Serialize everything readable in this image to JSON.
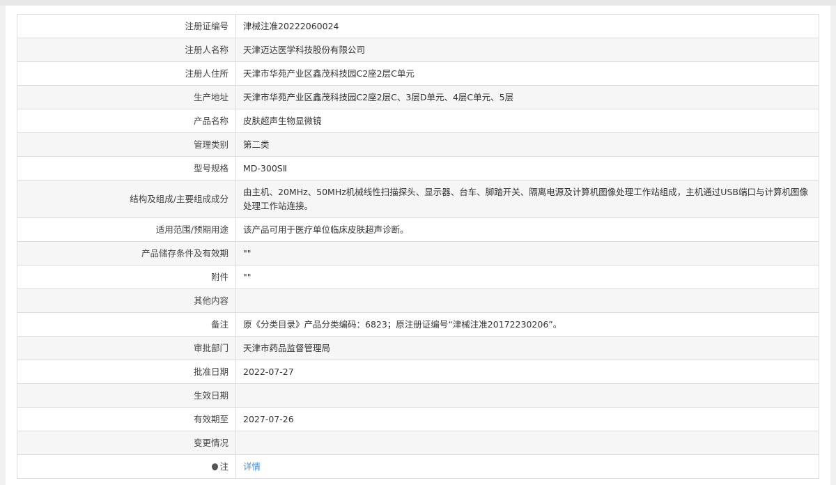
{
  "rows": [
    {
      "label": "注册证编号",
      "value": "津械注准20222060024"
    },
    {
      "label": "注册人名称",
      "value": "天津迈达医学科技股份有限公司"
    },
    {
      "label": "注册人住所",
      "value": "天津市华苑产业区鑫茂科技园C2座2层C单元"
    },
    {
      "label": "生产地址",
      "value": "天津市华苑产业区鑫茂科技园C2座2层C、3层D单元、4层C单元、5层"
    },
    {
      "label": "产品名称",
      "value": "皮肤超声生物显微镜"
    },
    {
      "label": "管理类别",
      "value": "第二类"
    },
    {
      "label": "型号规格",
      "value": "MD-300SⅡ"
    },
    {
      "label": "结构及组成/主要组成成分",
      "value": "由主机、20MHz、50MHz机械线性扫描探头、显示器、台车、脚踏开关、隔离电源及计算机图像处理工作站组成，主机通过USB端口与计算机图像处理工作站连接。"
    },
    {
      "label": "适用范围/预期用途",
      "value": "该产品可用于医疗单位临床皮肤超声诊断。"
    },
    {
      "label": "产品储存条件及有效期",
      "value": "\"\""
    },
    {
      "label": "附件",
      "value": "\"\""
    },
    {
      "label": "其他内容",
      "value": ""
    },
    {
      "label": "备注",
      "value": "原《分类目录》产品分类编码：6823；原注册证编号“津械注准20172230206”。"
    },
    {
      "label": "审批部门",
      "value": "天津市药品监督管理局"
    },
    {
      "label": "批准日期",
      "value": "2022-07-27"
    },
    {
      "label": "生效日期",
      "value": ""
    },
    {
      "label": "有效期至",
      "value": "2027-07-26"
    },
    {
      "label": "变更情况",
      "value": ""
    }
  ],
  "note": {
    "label": "注",
    "icon": "pin-icon",
    "link": "详情"
  },
  "colors": {
    "link": "#3a8ee6",
    "border": "#dcdcdc",
    "stripe": "#f6f6f6"
  }
}
